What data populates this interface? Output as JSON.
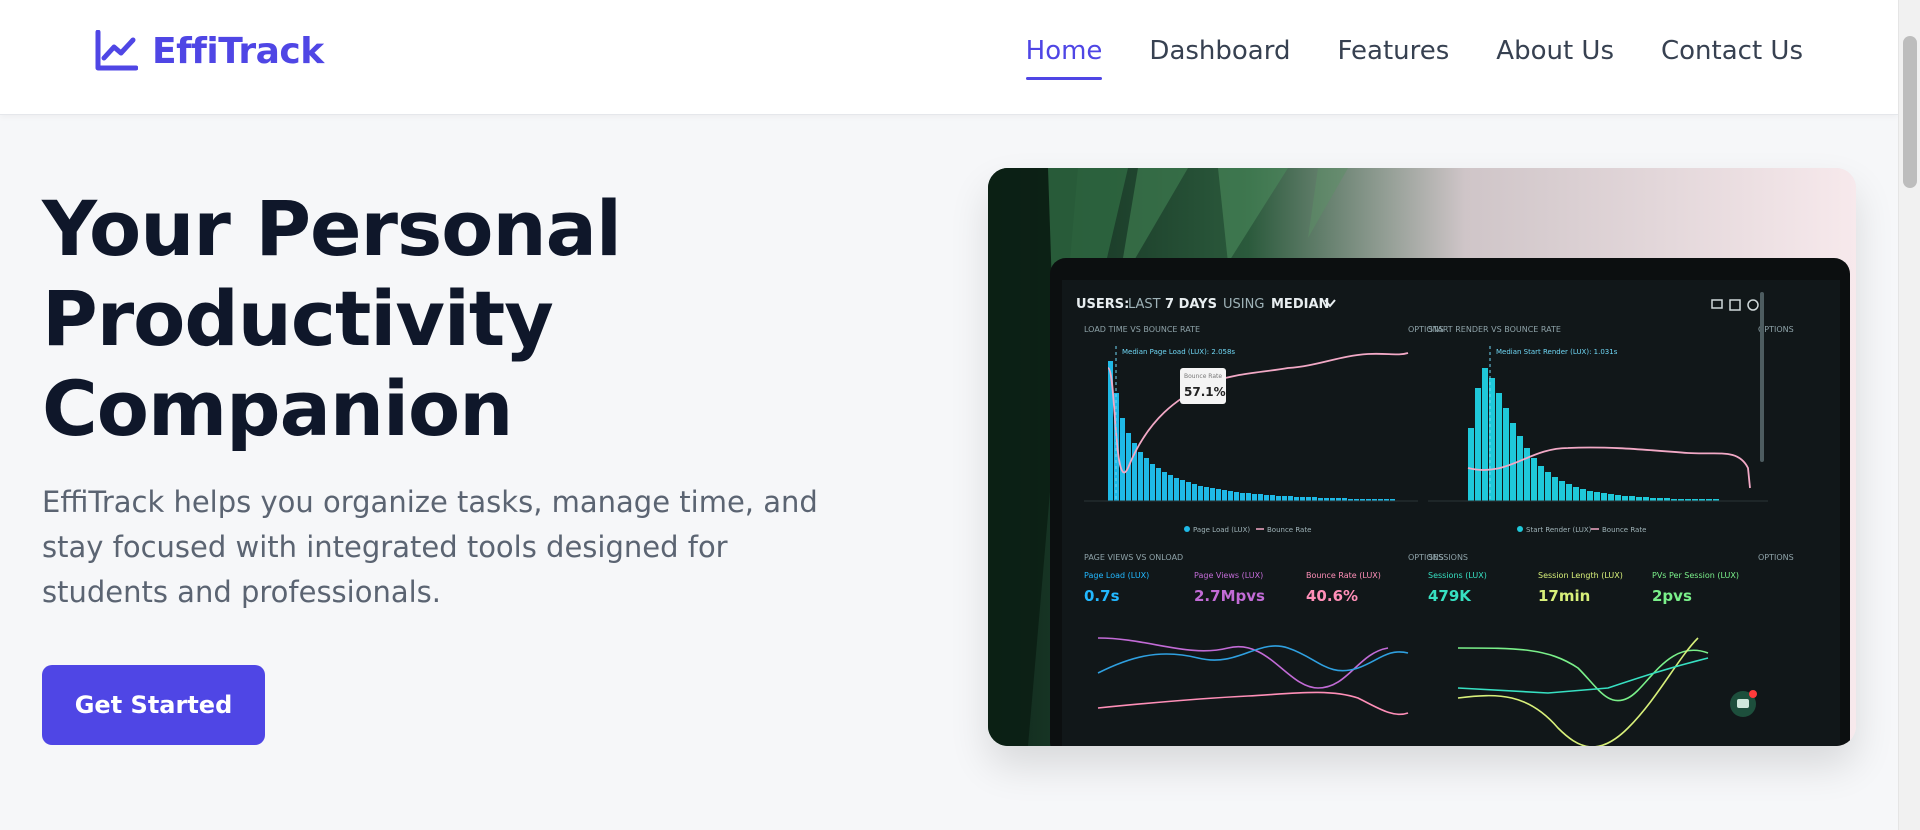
{
  "brand": {
    "name": "EffiTrack",
    "icon": "chart-line-icon",
    "color": "#4f46e5"
  },
  "nav": {
    "items": [
      {
        "label": "Home",
        "active": true
      },
      {
        "label": "Dashboard",
        "active": false
      },
      {
        "label": "Features",
        "active": false
      },
      {
        "label": "About Us",
        "active": false
      },
      {
        "label": "Contact Us",
        "active": false
      }
    ]
  },
  "hero": {
    "title_lines": [
      "Your Personal",
      "Productivity",
      "Companion"
    ],
    "description": "EffiTrack helps you organize tasks, manage time, and stay focused with integrated tools designed for students and professionals.",
    "cta_label": "Get Started"
  },
  "image": {
    "header_prefix": "USERS:",
    "header_mid": "LAST",
    "header_bold1": "7 DAYS",
    "header_mid2": "USING",
    "header_bold2": "MEDIAN",
    "panel1_title": "LOAD TIME VS BOUNCE RATE",
    "panel2_title": "START RENDER VS BOUNCE RATE",
    "panel3_title": "PAGE VIEWS VS ONLOAD",
    "panel4_title": "SESSIONS",
    "options": "OPTIONS",
    "tooltip_label": "Bounce Rate",
    "tooltip_value": "57.1%",
    "median1": "Median Page Load (LUX): 2.058s",
    "median2": "Median Start Render (LUX): 1.031s",
    "legend1a": "Page Load (LUX)",
    "legend1b": "Bounce Rate",
    "legend2a": "Start Render (LUX)",
    "legend2b": "Bounce Rate",
    "metrics": [
      {
        "label": "Page Load (LUX)",
        "value": "0.7s",
        "color": "#22b8ff"
      },
      {
        "label": "Page Views (LUX)",
        "value": "2.7Mpvs",
        "color": "#c26bd6"
      },
      {
        "label": "Bounce Rate (LUX)",
        "value": "40.6%",
        "color": "#ff8fb8"
      },
      {
        "label": "Sessions (LUX)",
        "value": "479K",
        "color": "#37e0c2"
      },
      {
        "label": "Session Length (LUX)",
        "value": "17min",
        "color": "#d8f07a"
      },
      {
        "label": "PVs Per Session (LUX)",
        "value": "2pvs",
        "color": "#7af08a"
      }
    ]
  }
}
